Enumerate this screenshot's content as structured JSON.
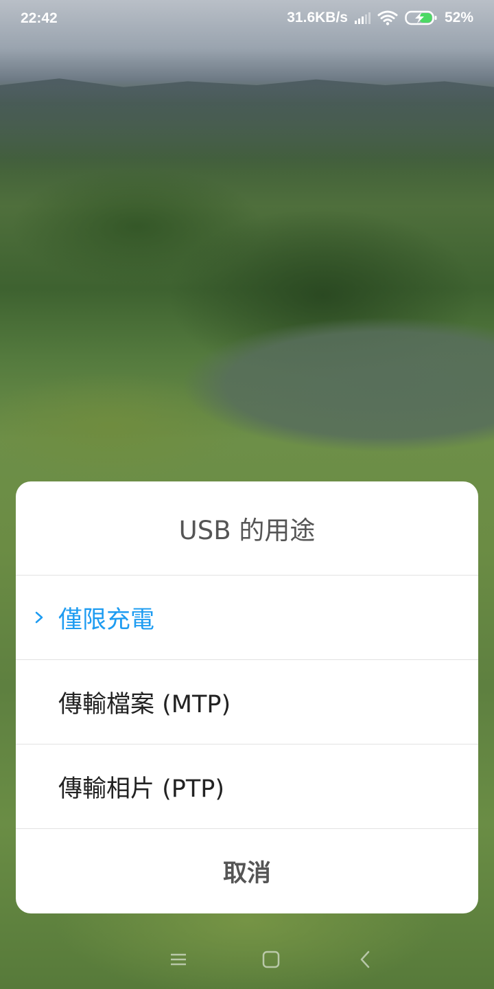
{
  "status_bar": {
    "time": "22:42",
    "network_speed": "31.6KB/s",
    "battery_percent": "52%",
    "icons": [
      "signal-icon",
      "wifi-icon",
      "battery-charging-icon"
    ]
  },
  "dialog": {
    "title": "USB 的用途",
    "options": [
      {
        "label": "僅限充電",
        "selected": true
      },
      {
        "label": "傳輸檔案 (MTP)",
        "selected": false
      },
      {
        "label": "傳輸相片 (PTP)",
        "selected": false
      }
    ],
    "cancel_label": "取消",
    "accent_color": "#1e9cf1"
  },
  "nav_bar": {
    "icons": [
      "menu-icon",
      "home-icon",
      "back-icon"
    ]
  }
}
